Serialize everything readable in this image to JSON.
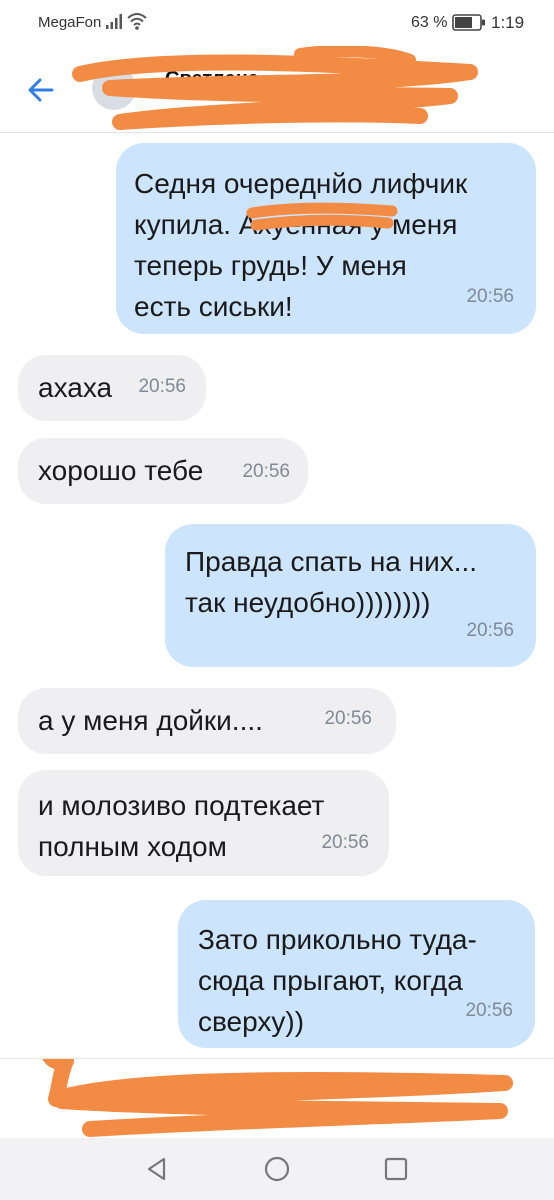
{
  "status_bar": {
    "carrier": "MegaFon",
    "battery_percent": "63 %",
    "time": "1:19",
    "icons": [
      "signal-icon",
      "wifi-icon",
      "battery-icon"
    ]
  },
  "header": {
    "back_icon": "arrow-left-icon",
    "contact_name": "Светлана",
    "contact_name_redacted": true
  },
  "messages": [
    {
      "direction": "out",
      "text": "Седня очереднйо лифчик\nкупила. Ахуенная у меня\nтеперь грудь! У меня\nесть сиськи!",
      "time": "20:56"
    },
    {
      "direction": "in",
      "text": "ахаха",
      "time": "20:56"
    },
    {
      "direction": "in",
      "text": "хорошо тебе",
      "time": "20:56"
    },
    {
      "direction": "out",
      "text": "Правда спать на них...\nтак неудобно))))))))",
      "time": "20:56"
    },
    {
      "direction": "in",
      "text": "а у меня дойки....",
      "time": "20:56"
    },
    {
      "direction": "in",
      "text": "и молозиво подтекает\nполным ходом",
      "time": "20:56"
    },
    {
      "direction": "out",
      "text": "Зато прикольно туда-\nсюда прыгают, когда\nсверху))",
      "time": "20:56"
    }
  ],
  "composer": {
    "placeholder": "",
    "redacted": true
  },
  "nav_bar": {
    "buttons": [
      "back-triangle-icon",
      "home-circle-icon",
      "recents-square-icon"
    ]
  },
  "colors": {
    "outgoing_bubble": "#cce4fc",
    "incoming_bubble": "#efeff1",
    "timestamp": "#7f8a96",
    "accent_blue": "#2f7fe0",
    "redaction_orange": "#f28c45"
  }
}
